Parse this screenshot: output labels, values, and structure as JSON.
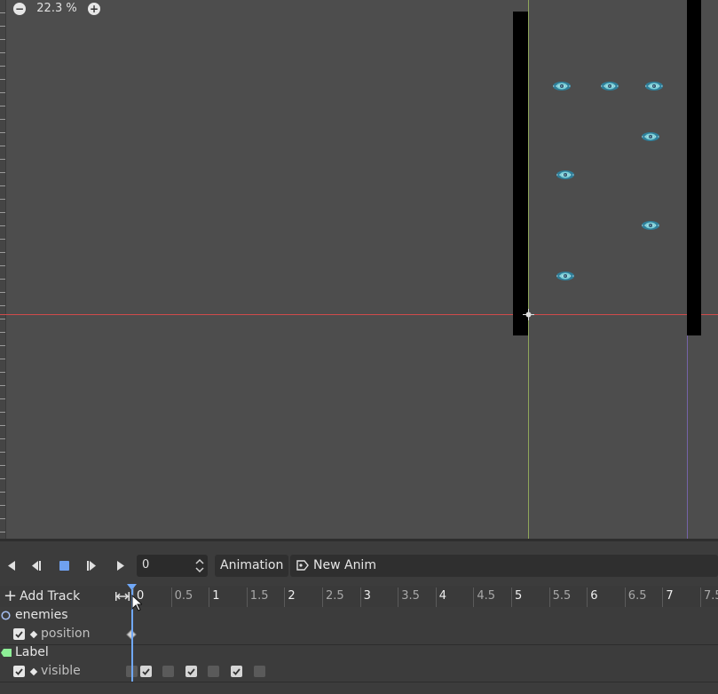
{
  "viewport": {
    "zoom_label": "22.3 %",
    "zoom_out_icon": "zoom-out-icon",
    "zoom_in_icon": "zoom-in-icon",
    "enemy_icon": "enemy-sprite-icon",
    "origin_icon": "origin-crosshair-icon",
    "colors": {
      "background": "#4d4d4d",
      "x_axis": "#cf4b4b",
      "y_axis": "#8fa75b",
      "screen_edge": "#7563a8",
      "walls": "#000000"
    }
  },
  "toolbar": {
    "buttons": [
      {
        "icon": "play-backwards-icon"
      },
      {
        "icon": "play-backwards-from-end-icon"
      },
      {
        "icon": "stop-icon"
      },
      {
        "icon": "play-from-start-icon"
      },
      {
        "icon": "play-icon"
      }
    ],
    "time_value": "0",
    "animation_label": "Animation",
    "current_animation": "New Anim",
    "animation_icon": "animation-icon"
  },
  "timeline": {
    "add_track_label": "Add Track",
    "fit_icon": "fit-timeline-icon",
    "ticks": [
      "0",
      "0.5",
      "1",
      "1.5",
      "2",
      "2.5",
      "3",
      "3.5",
      "4",
      "4.5",
      "5",
      "5.5",
      "6",
      "6.5",
      "7",
      "7.5"
    ],
    "playhead_time": 0,
    "playhead_color": "#70a8f8"
  },
  "tracks": [
    {
      "node": "enemies",
      "node_icon": "node-circle-icon",
      "property": "position",
      "enabled": true,
      "keyframes": [
        0
      ]
    },
    {
      "node": "Label",
      "node_icon": "label-node-icon",
      "property": "visible",
      "enabled": true,
      "keyframes_checked": [
        false,
        true,
        false,
        true,
        false,
        true,
        false
      ]
    }
  ]
}
